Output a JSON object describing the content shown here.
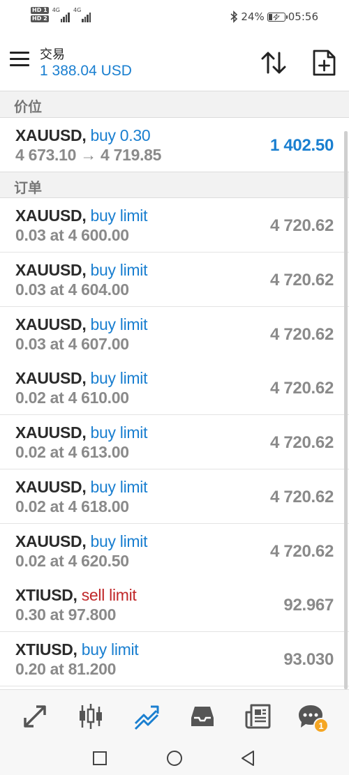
{
  "status_bar": {
    "sim1": "HD 1",
    "sim2": "HD 2",
    "net1": "4G",
    "net2": "4G",
    "battery": "24%",
    "battery_level": 0.24,
    "time": "05:56"
  },
  "app_bar": {
    "title": "交易",
    "balance": "1 388.04 USD"
  },
  "sections": {
    "prices": "价位",
    "orders": "订单"
  },
  "position": {
    "symbol": "XAUUSD,",
    "side": "buy 0.30",
    "detail": "4 673.10 → 4 719.85",
    "price": "1 402.50"
  },
  "orders": [
    {
      "symbol": "XAUUSD,",
      "side": "buy limit",
      "type": "buy",
      "detail": "0.03 at 4 600.00",
      "price": "4 720.62"
    },
    {
      "symbol": "XAUUSD,",
      "side": "buy limit",
      "type": "buy",
      "detail": "0.03 at 4 604.00",
      "price": "4 720.62"
    },
    {
      "symbol": "XAUUSD,",
      "side": "buy limit",
      "type": "buy",
      "detail": "0.03 at 4 607.00",
      "price": "4 720.62"
    },
    {
      "symbol": "XAUUSD,",
      "side": "buy limit",
      "type": "buy",
      "detail": "0.02 at 4 610.00",
      "price": "4 720.62"
    },
    {
      "symbol": "XAUUSD,",
      "side": "buy limit",
      "type": "buy",
      "detail": "0.02 at 4 613.00",
      "price": "4 720.62"
    },
    {
      "symbol": "XAUUSD,",
      "side": "buy limit",
      "type": "buy",
      "detail": "0.02 at 4 618.00",
      "price": "4 720.62"
    },
    {
      "symbol": "XAUUSD,",
      "side": "buy limit",
      "type": "buy",
      "detail": "0.02 at 4 620.50",
      "price": "4 720.62"
    },
    {
      "symbol": "XTIUSD,",
      "side": "sell limit",
      "type": "sell",
      "detail": "0.30 at 97.800",
      "price": "92.967"
    },
    {
      "symbol": "XTIUSD,",
      "side": "buy limit",
      "type": "buy",
      "detail": "0.20 at 81.200",
      "price": "93.030"
    }
  ],
  "tab_bar": {
    "items": [
      "quotes-icon",
      "chart-icon",
      "trade-icon",
      "history-icon",
      "news-icon",
      "chat-icon"
    ],
    "active": "trade-icon",
    "chat_badge": "1"
  },
  "nav_bar": {
    "items": [
      "recents-icon",
      "home-icon",
      "back-icon"
    ]
  },
  "colors": {
    "accent": "#1a7fd0",
    "sell": "#c0282a",
    "muted": "#8a8a8a",
    "badge": "#f5a623"
  }
}
